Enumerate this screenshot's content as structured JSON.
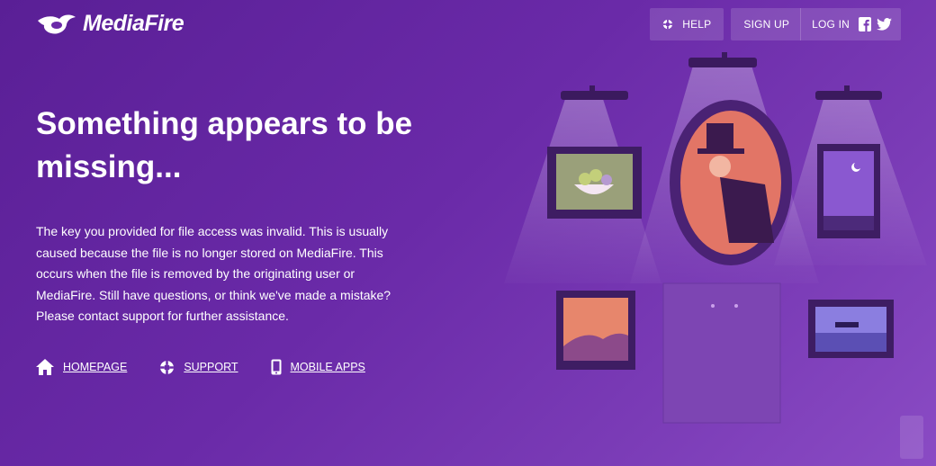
{
  "brand": {
    "name": "MediaFire"
  },
  "nav": {
    "help": "HELP",
    "signup": "SIGN UP",
    "login": "LOG IN"
  },
  "main": {
    "title": "Something appears to be missing...",
    "description": "The key you provided for file access was invalid. This is usually caused because the file is no longer stored on MediaFire. This occurs when the file is removed by the originating user or MediaFire. Still have questions, or think we've made a mistake? Please contact support for further assistance."
  },
  "links": [
    {
      "label": "HOMEPAGE",
      "icon": "home-icon"
    },
    {
      "label": "SUPPORT",
      "icon": "lifebuoy-icon"
    },
    {
      "label": "MOBILE APPS",
      "icon": "phone-icon"
    }
  ],
  "colors": {
    "background": "#6a2aa8",
    "accent": "#ffffff"
  }
}
